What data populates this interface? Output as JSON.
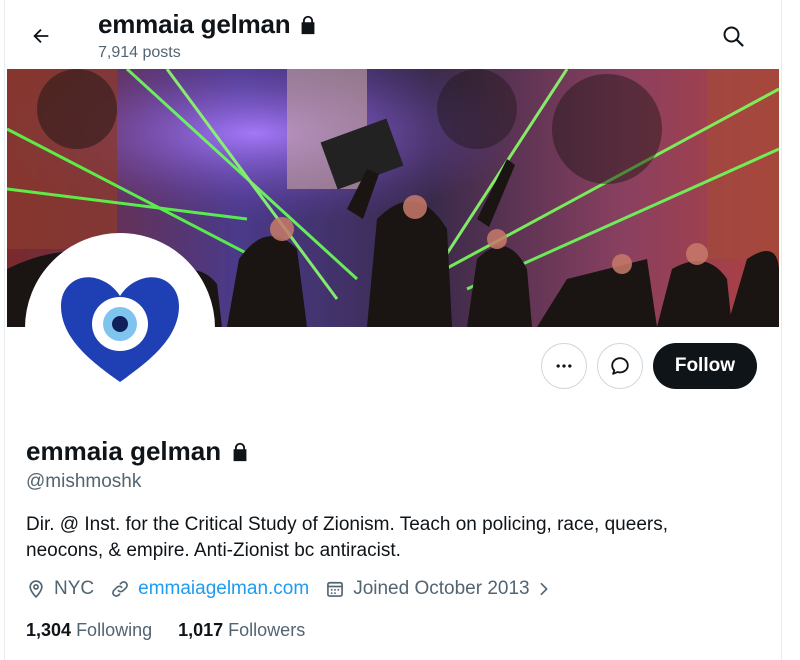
{
  "header": {
    "name": "emmaia gelman",
    "posts": "7,914 posts"
  },
  "profile": {
    "name": "emmaia gelman",
    "handle": "@mishmoshk",
    "bio_line1": "Dir. @ Inst. for the Critical Study of Zionism. Teach on policing, race, queers,",
    "bio_line2": "neocons, & empire. Anti-Zionist bc antiracist.",
    "location": "NYC",
    "website": "emmaiagelman.com",
    "joined": "Joined October 2013",
    "following_count": "1,304",
    "following_label": "Following",
    "followers_count": "1,017",
    "followers_label": "Followers"
  },
  "actions": {
    "follow_label": "Follow"
  },
  "icons": {
    "back": "arrow-left-icon",
    "search": "search-icon",
    "lock": "lock-icon",
    "more": "more-horizontal-icon",
    "message": "message-bubble-icon",
    "location": "location-pin-icon",
    "link": "link-icon",
    "calendar": "calendar-icon"
  },
  "colors": {
    "text": "#0f1419",
    "secondary": "#536471",
    "link": "#1d9bf0",
    "button_dark": "#0f1419",
    "avatar_heart": "#1f3fb5",
    "avatar_eye": "#7ec4ef"
  }
}
